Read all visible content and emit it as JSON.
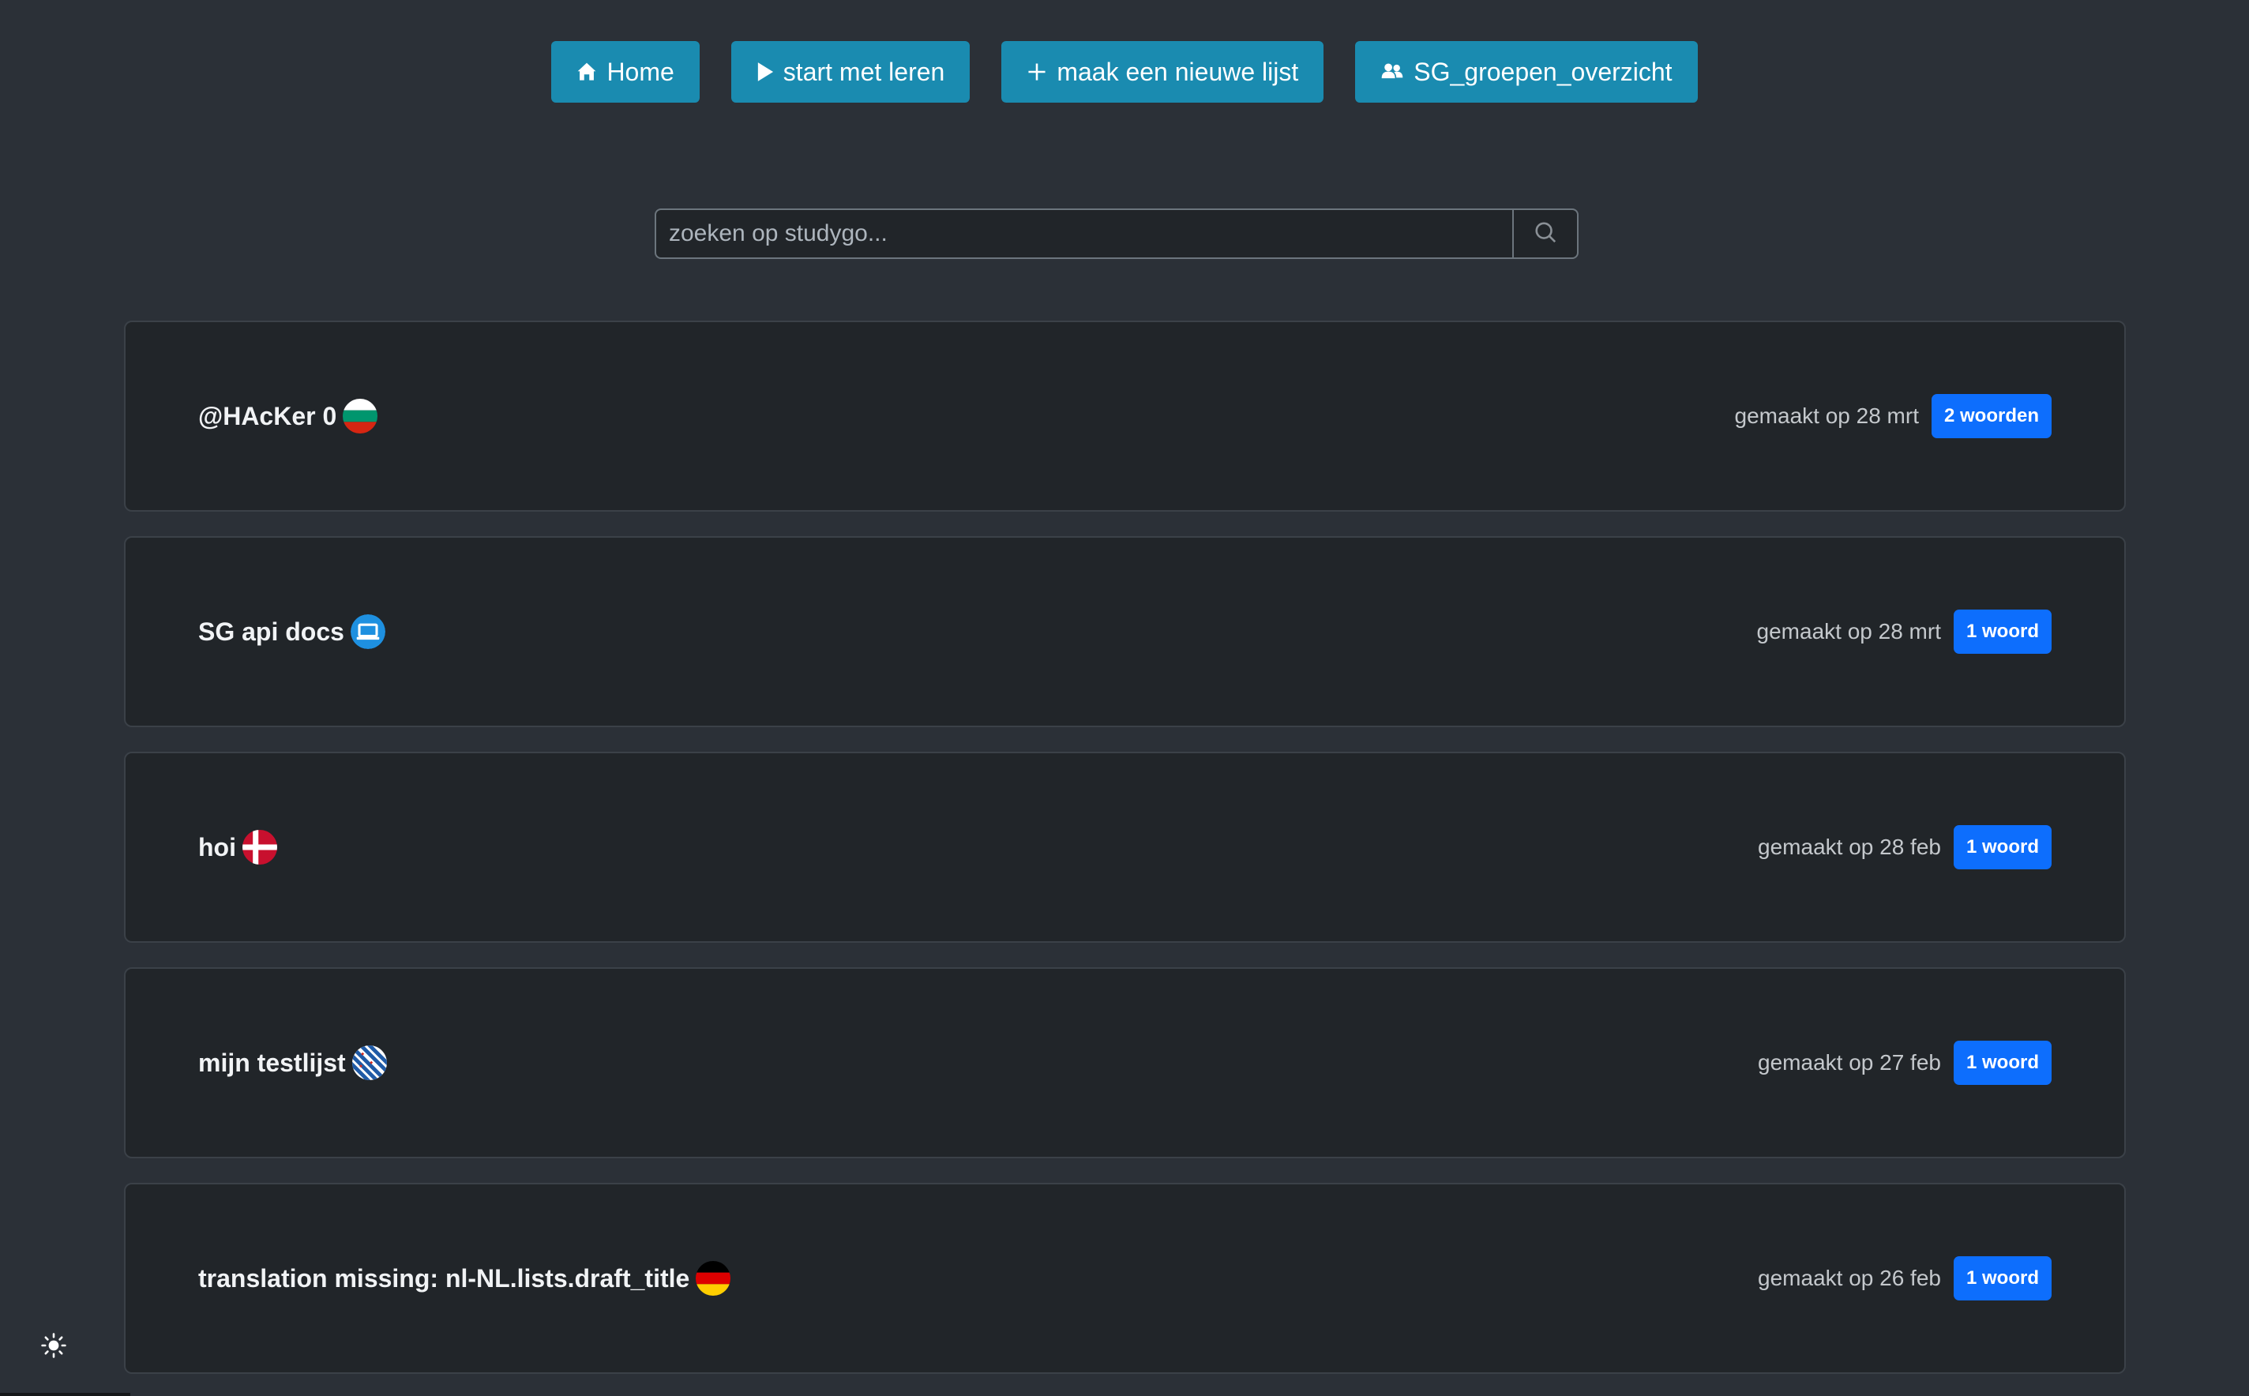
{
  "nav": {
    "home": "Home",
    "start": "start met leren",
    "new_list": "maak een nieuwe lijst",
    "groups": "SG_groepen_overzicht"
  },
  "search": {
    "placeholder": "zoeken op studygo..."
  },
  "lists": [
    {
      "title": "@HAcKer 0",
      "flag": "bulgaria-flag-icon",
      "date": "gemaakt op 28 mrt",
      "count": "2 woorden"
    },
    {
      "title": "SG api docs",
      "flag": "laptop-icon",
      "date": "gemaakt op 28 mrt",
      "count": "1 woord"
    },
    {
      "title": "hoi",
      "flag": "denmark-flag-icon",
      "date": "gemaakt op 28 feb",
      "count": "1 woord"
    },
    {
      "title": "mijn testlijst",
      "flag": "friesland-flag-icon",
      "date": "gemaakt op 27 feb",
      "count": "1 woord"
    },
    {
      "title": "translation missing: nl-NL.lists.draft_title",
      "flag": "germany-flag-icon",
      "date": "gemaakt op 26 feb",
      "count": "1 woord"
    }
  ],
  "colors": {
    "background": "#2b3037",
    "card": "#212529",
    "nav_button": "#1a8bb0",
    "badge": "#0d6efd"
  }
}
